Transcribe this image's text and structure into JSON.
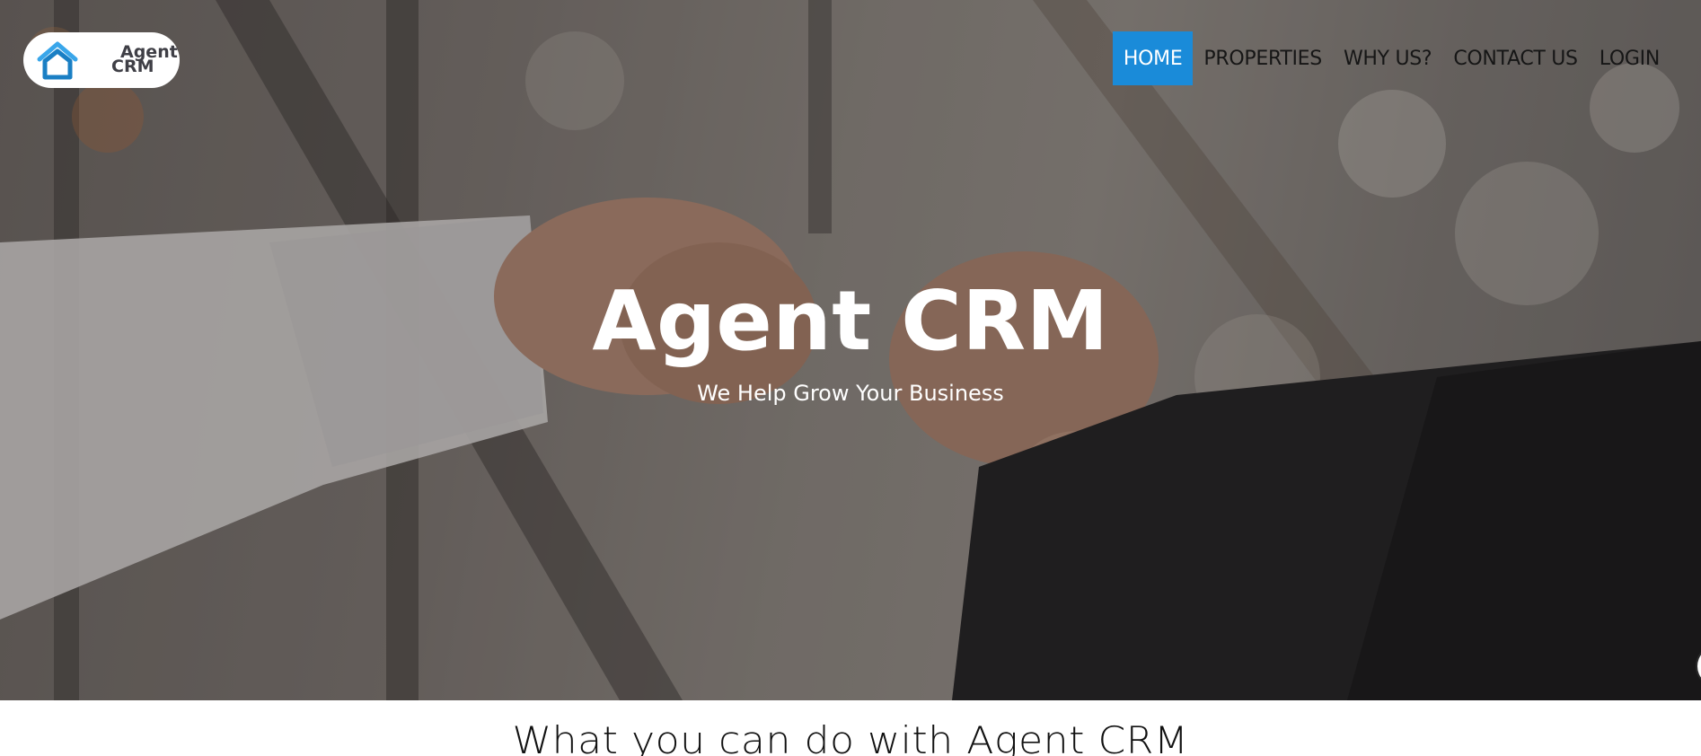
{
  "brand": {
    "logo_line1": "Agent",
    "logo_line2": "CRM",
    "logo_icon": "house-icon",
    "accent_color": "#1a8bd9"
  },
  "nav": {
    "items": [
      {
        "label": "HOME",
        "active": true
      },
      {
        "label": "PROPERTIES",
        "active": false
      },
      {
        "label": "WHY US?",
        "active": false
      },
      {
        "label": "CONTACT US",
        "active": false
      },
      {
        "label": "LOGIN",
        "active": false
      }
    ]
  },
  "hero": {
    "title": "Agent CRM",
    "subtitle": "We Help Grow Your Business",
    "background": "fist-bump-photo"
  },
  "section": {
    "title": "What you can do with Agent CRM"
  }
}
